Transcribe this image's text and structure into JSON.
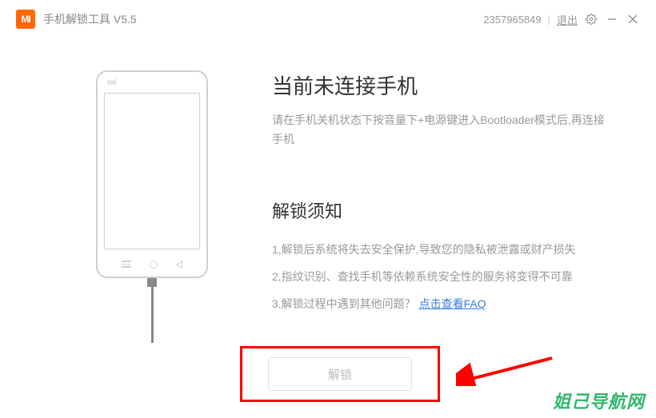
{
  "titlebar": {
    "logo_text": "MI",
    "app_title": "手机解锁工具  V5.5",
    "user_id": "2357965849",
    "logout": "退出"
  },
  "phone": {
    "brand": "mi"
  },
  "status": {
    "heading": "当前未连接手机",
    "instruction": "请在手机关机状态下按音量下+电源键进入Bootloader模式后,再连接手机"
  },
  "notice": {
    "heading": "解锁须知",
    "items": [
      "1,解锁后系统将失去安全保护,导致您的隐私被泄露或财产损失",
      "2,指纹识别、查找手机等依赖系统安全性的服务将变得不可靠",
      "3,解锁过程中遇到其他问题？"
    ],
    "faq_link": "点击查看FAQ"
  },
  "action": {
    "unlock_label": "解锁"
  },
  "watermark": "姐己导航网"
}
